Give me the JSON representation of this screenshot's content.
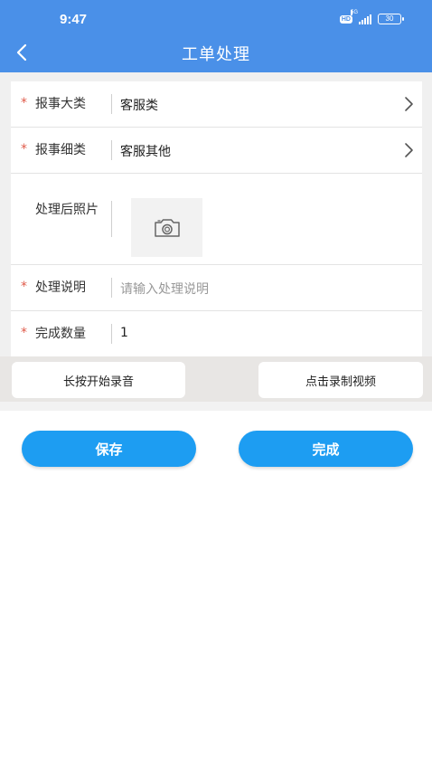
{
  "status_bar": {
    "time": "9:47",
    "hd": "HD",
    "network": "5G",
    "battery": "30"
  },
  "header": {
    "title": "工单处理"
  },
  "form": {
    "required_mark": "*",
    "category": {
      "label": "报事大类",
      "value": "客服类"
    },
    "subcategory": {
      "label": "报事细类",
      "value": "客服其他"
    },
    "photo": {
      "label": "处理后照片"
    },
    "description": {
      "label": "处理说明",
      "placeholder": "请输入处理说明"
    },
    "quantity": {
      "label": "完成数量",
      "value": "1"
    }
  },
  "media": {
    "record_audio_label": "长按开始录音",
    "record_video_label": "点击录制视频"
  },
  "actions": {
    "save_label": "保存",
    "complete_label": "完成"
  },
  "colors": {
    "header": "#4a90e8",
    "primary_button": "#1d9df2",
    "required": "#e05a4a"
  },
  "icons": {
    "back": "chevron-left-icon",
    "row_arrow": "chevron-right-icon",
    "photo": "camera-icon"
  }
}
